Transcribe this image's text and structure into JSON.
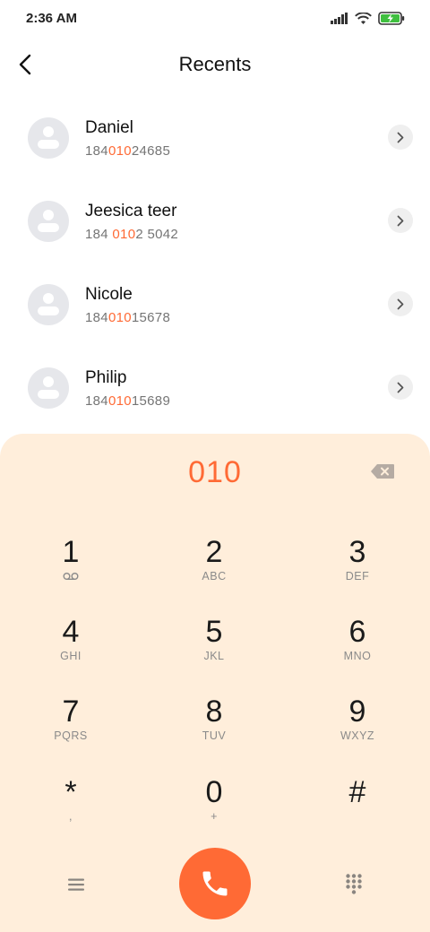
{
  "status_bar": {
    "time": "2:36 AM",
    "icons": [
      "signal-icon",
      "wifi-icon",
      "battery-charging-icon"
    ],
    "battery_color": "#3fbf3f"
  },
  "header": {
    "back_icon": "chevron-left-icon",
    "title": "Recents"
  },
  "contacts": [
    {
      "name": "Daniel",
      "number_parts": [
        "184",
        "010",
        "24685"
      ]
    },
    {
      "name": "Jeesica teer",
      "number_parts": [
        "184 ",
        "010",
        "2 5042"
      ]
    },
    {
      "name": "Nicole",
      "number_parts": [
        "184",
        "010",
        "15678"
      ]
    },
    {
      "name": "Philip",
      "number_parts": [
        "184",
        "010",
        "15689"
      ]
    }
  ],
  "dialpad": {
    "input": "010",
    "keys": [
      {
        "digit": "1",
        "letters": ""
      },
      {
        "digit": "2",
        "letters": "ABC"
      },
      {
        "digit": "3",
        "letters": "DEF"
      },
      {
        "digit": "4",
        "letters": "GHI"
      },
      {
        "digit": "5",
        "letters": "JKL"
      },
      {
        "digit": "6",
        "letters": "MNO"
      },
      {
        "digit": "7",
        "letters": "PQRS"
      },
      {
        "digit": "8",
        "letters": "TUV"
      },
      {
        "digit": "9",
        "letters": "WXYZ"
      },
      {
        "digit": "*",
        "letters": ","
      },
      {
        "digit": "0",
        "letters": "+"
      },
      {
        "digit": "#",
        "letters": ""
      }
    ],
    "bottom_icons": [
      "menu-icon",
      "phone-icon",
      "keypad-icon"
    ]
  },
  "colors": {
    "accent": "#ff6a35",
    "dialpad_bg": "#ffeedb",
    "avatar_bg": "#e6e7eb"
  }
}
